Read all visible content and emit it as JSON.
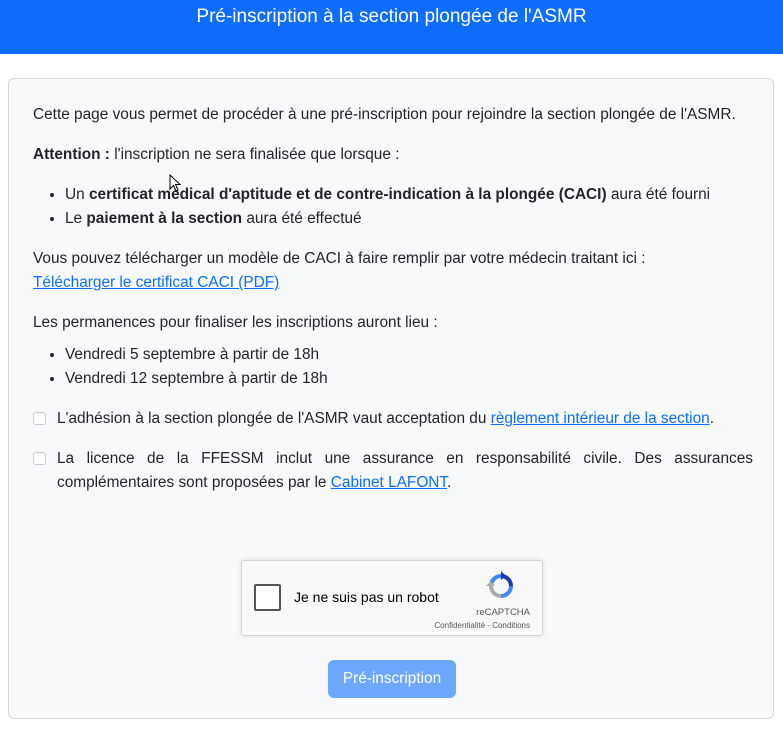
{
  "header": {
    "title": "Pré-inscription à la section plongée de l'ASMR",
    "bg_color": "#0d6efd"
  },
  "intro": {
    "text": "Cette page vous permet de procéder à une pré-inscription pour rejoindre la section plongée de l'ASMR."
  },
  "attention": {
    "label": "Attention :",
    "text": "l'inscription ne sera finalisée que lorsque :",
    "items": [
      {
        "pre": "Un ",
        "bold": "certificat médical d'aptitude et de contre-indication à la plongée (CACI)",
        "post": " aura été fourni"
      },
      {
        "pre": "Le ",
        "bold": "paiement à la section",
        "post": " aura été effectué"
      }
    ]
  },
  "caci": {
    "text": "Vous pouvez télécharger un modèle de CACI à faire remplir par votre médecin traitant ici :",
    "link_label": "Télécharger le certificat CACI (PDF)"
  },
  "permanences": {
    "text": "Les permanences pour finaliser les inscriptions auront lieu :",
    "items": [
      "Vendredi 5 septembre à partir de 18h",
      "Vendredi 12 septembre à partir de 18h"
    ]
  },
  "checkboxes": {
    "reglement": {
      "text": "L'adhésion à la section plongée de l'ASMR vaut acceptation du ",
      "link_label": "règlement intérieur de la section",
      "suffix": ".",
      "checked": false
    },
    "licence": {
      "text": "La licence de la FFESSM inclut une assurance en responsabilité civile. Des assurances complémentaires sont proposées par le ",
      "link_label": "Cabinet LAFONT",
      "suffix": ".",
      "checked": false
    }
  },
  "captcha": {
    "label": "Je ne suis pas un robot",
    "brand": "reCAPTCHA",
    "links": "Confidentialité - Conditions",
    "checked": false
  },
  "submit": {
    "label": "Pré-inscription",
    "color": "#6ea8fe"
  },
  "colors": {
    "link": "#0d6efd",
    "card_bg": "#f8f9fa"
  }
}
